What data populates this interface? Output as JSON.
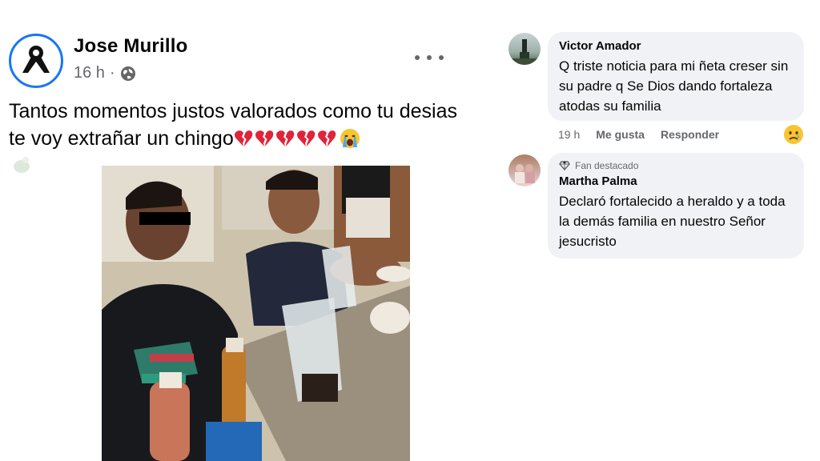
{
  "post": {
    "author": "Jose Murillo",
    "time": "16 h",
    "audience_icon": "globe-icon",
    "text": "Tantos momentos justos valorados como tu desias te voy extrañar un chingo",
    "emoji_after_text": [
      "broken-heart",
      "broken-heart",
      "broken-heart",
      "broken-heart",
      "broken-heart",
      "crying-face"
    ],
    "menu_icon": "more-options-icon",
    "avatar_icon": "mourning-ribbon-icon"
  },
  "comments": [
    {
      "author": "Victor Amador",
      "text": "Q triste noticia para mi ñeta creser sin su padre q Se Dios dando fortaleza atodas su familia",
      "time": "19 h",
      "like_label": "Me gusta",
      "reply_label": "Responder",
      "reaction_icon": "sad-face-icon"
    },
    {
      "badge": "Fan destacado",
      "badge_icon": "diamond-icon",
      "author": "Martha Palma",
      "text": "Declaró fortalecido a heraldo y a toda la demás familia en nuestro Señor jesucristo"
    }
  ],
  "colors": {
    "accent": "#1877f2",
    "secondary_text": "#65676b",
    "bubble_bg": "#f0f2f5",
    "broken_heart": "#e0243a"
  }
}
